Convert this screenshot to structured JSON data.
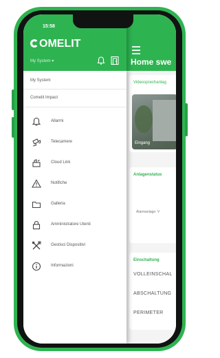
{
  "status_bar": {
    "time": "15:58"
  },
  "brand": {
    "logo_text": "OMELIT",
    "accent": "#2eb351"
  },
  "drawer": {
    "system_select": "My System ▾",
    "header_icons": [
      "bell-icon",
      "door-icon"
    ],
    "links": [
      "My System",
      "Comelit Impact"
    ],
    "items": [
      {
        "label": "Allarmi",
        "icon": "bell-icon"
      },
      {
        "label": "Telecamere",
        "icon": "camera-icon"
      },
      {
        "label": "Cloud Link",
        "icon": "cloud-link-icon"
      },
      {
        "label": "Notifiche",
        "icon": "warning-icon"
      },
      {
        "label": "Galleria",
        "icon": "folder-icon"
      },
      {
        "label": "Amministratore Utenti",
        "icon": "lock-icon"
      },
      {
        "label": "Gestisci Dispositivi",
        "icon": "tools-icon"
      },
      {
        "label": "Informazioni",
        "icon": "info-icon"
      }
    ]
  },
  "main": {
    "title": "Home swe",
    "cards": {
      "video": {
        "label": "Videosprechanlag",
        "caption": "Eingang"
      },
      "system": {
        "label": "Anlagenstatus",
        "sub": "Alarmanlage: V"
      },
      "arming": {
        "label": "Einschaltung",
        "rows": [
          "VOLLEINSCHAL",
          "ABSCHALTUNG",
          "PERIMETER"
        ]
      }
    }
  }
}
